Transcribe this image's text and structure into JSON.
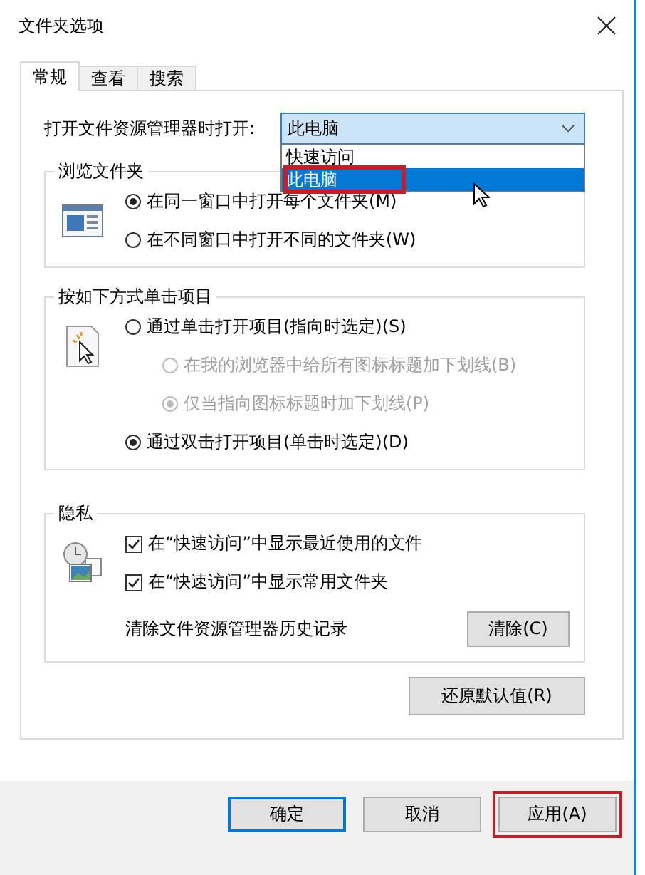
{
  "window": {
    "title": "文件夹选项"
  },
  "tabs": [
    {
      "label": "常规",
      "selected": true
    },
    {
      "label": "查看",
      "selected": false
    },
    {
      "label": "搜索",
      "selected": false
    }
  ],
  "open_with": {
    "label": "打开文件资源管理器时打开:",
    "value": "此电脑",
    "expanded": true,
    "options": [
      {
        "label": "快速访问",
        "selected": false,
        "highlighted": false
      },
      {
        "label": "此电脑",
        "selected": true,
        "highlighted": true
      }
    ]
  },
  "groups": [
    {
      "title": "浏览文件夹",
      "options": [
        {
          "kind": "radio",
          "label": "在同一窗口中打开每个文件夹(M)",
          "checked": true,
          "disabled": false
        },
        {
          "kind": "radio",
          "label": "在不同窗口中打开不同的文件夹(W)",
          "checked": false,
          "disabled": false
        }
      ]
    },
    {
      "title": "按如下方式单击项目",
      "options": [
        {
          "kind": "radio",
          "label": "通过单击打开项目(指向时选定)(S)",
          "checked": false,
          "disabled": false,
          "children": [
            {
              "kind": "radio",
              "label": "在我的浏览器中给所有图标标题加下划线(B)",
              "checked": false,
              "disabled": true
            },
            {
              "kind": "radio",
              "label": "仅当指向图标标题时加下划线(P)",
              "checked": true,
              "disabled": true
            }
          ]
        },
        {
          "kind": "radio",
          "label": "通过双击打开项目(单击时选定)(D)",
          "checked": true,
          "disabled": false
        }
      ]
    },
    {
      "title": "隐私",
      "options": [
        {
          "kind": "checkbox",
          "label": "在“快速访问”中显示最近使用的文件",
          "checked": true
        },
        {
          "kind": "checkbox",
          "label": "在“快速访问”中显示常用文件夹",
          "checked": true
        },
        {
          "kind": "action",
          "label": "清除文件资源管理器历史记录",
          "button": "清除(C)"
        }
      ]
    }
  ],
  "restore_button": "还原默认值(R)",
  "footer_buttons": [
    {
      "label": "确定",
      "default": true,
      "highlighted": false
    },
    {
      "label": "取消",
      "default": false,
      "highlighted": false
    },
    {
      "label": "应用(A)",
      "default": false,
      "highlighted": true
    }
  ]
}
